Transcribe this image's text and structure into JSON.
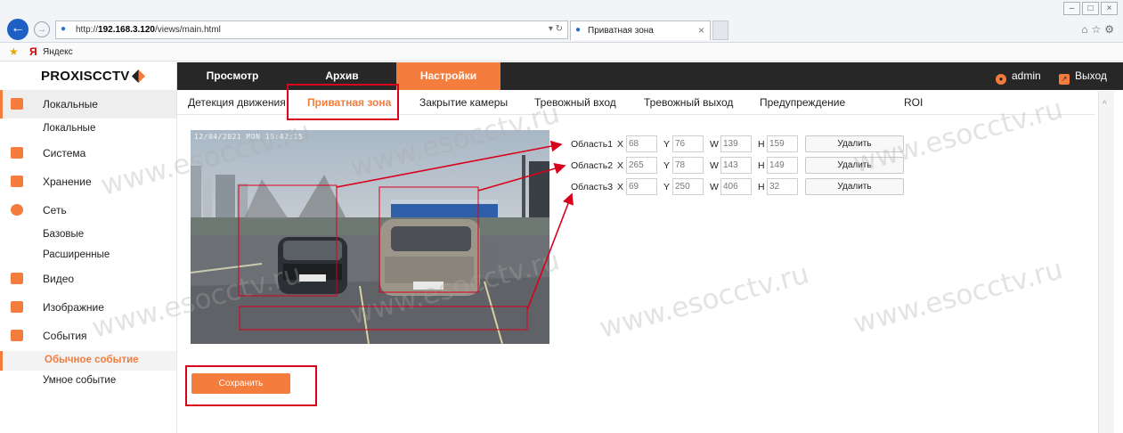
{
  "browser": {
    "url_prefix": "http://",
    "url_host": "192.168.3.120",
    "url_path": "/views/main.html",
    "tab_title": "Приватная зона",
    "favorite_label": "Яндекс"
  },
  "header": {
    "logo_text": "PROXISCCTV",
    "nav": [
      {
        "label": "Просмотр"
      },
      {
        "label": "Архив"
      },
      {
        "label": "Настройки"
      }
    ],
    "user": "admin",
    "logout": "Выход"
  },
  "sidebar": {
    "items": [
      {
        "label": "Локальные",
        "icon": "monitor-icon"
      },
      {
        "label": "Локальные"
      },
      {
        "label": "Система",
        "icon": "system-icon"
      },
      {
        "label": "Хранение",
        "icon": "storage-icon"
      },
      {
        "label": "Сеть",
        "icon": "network-icon"
      },
      {
        "label": "Базовые"
      },
      {
        "label": "Расширенные"
      },
      {
        "label": "Видео",
        "icon": "video-icon"
      },
      {
        "label": "Изображние",
        "icon": "image-icon"
      },
      {
        "label": "События",
        "icon": "events-icon"
      },
      {
        "label": "Обычное событие"
      },
      {
        "label": "Умное событие"
      }
    ]
  },
  "subtabs": [
    {
      "label": "Детекция движения"
    },
    {
      "label": "Приватная зона"
    },
    {
      "label": "Закрытие камеры"
    },
    {
      "label": "Тревожный вход"
    },
    {
      "label": "Тревожный выход"
    },
    {
      "label": "Предупреждение"
    },
    {
      "label": "ROI"
    }
  ],
  "camera": {
    "osd": "12/04/2021 MON 16:42:15"
  },
  "areas": [
    {
      "label": "Область1",
      "x": "68",
      "y": "76",
      "w": "139",
      "h": "159",
      "delete": "Удалить"
    },
    {
      "label": "Область2",
      "x": "265",
      "y": "78",
      "w": "143",
      "h": "149",
      "delete": "Удалить"
    },
    {
      "label": "Область3",
      "x": "69",
      "y": "250",
      "w": "406",
      "h": "32",
      "delete": "Удалить"
    }
  ],
  "coord_labels": {
    "x": "X",
    "y": "Y",
    "w": "W",
    "h": "H"
  },
  "save_label": "Сохранить",
  "watermark": "www.esocctv.ru",
  "accent_color": "#f47c3c",
  "annotation_color": "#d9001b"
}
